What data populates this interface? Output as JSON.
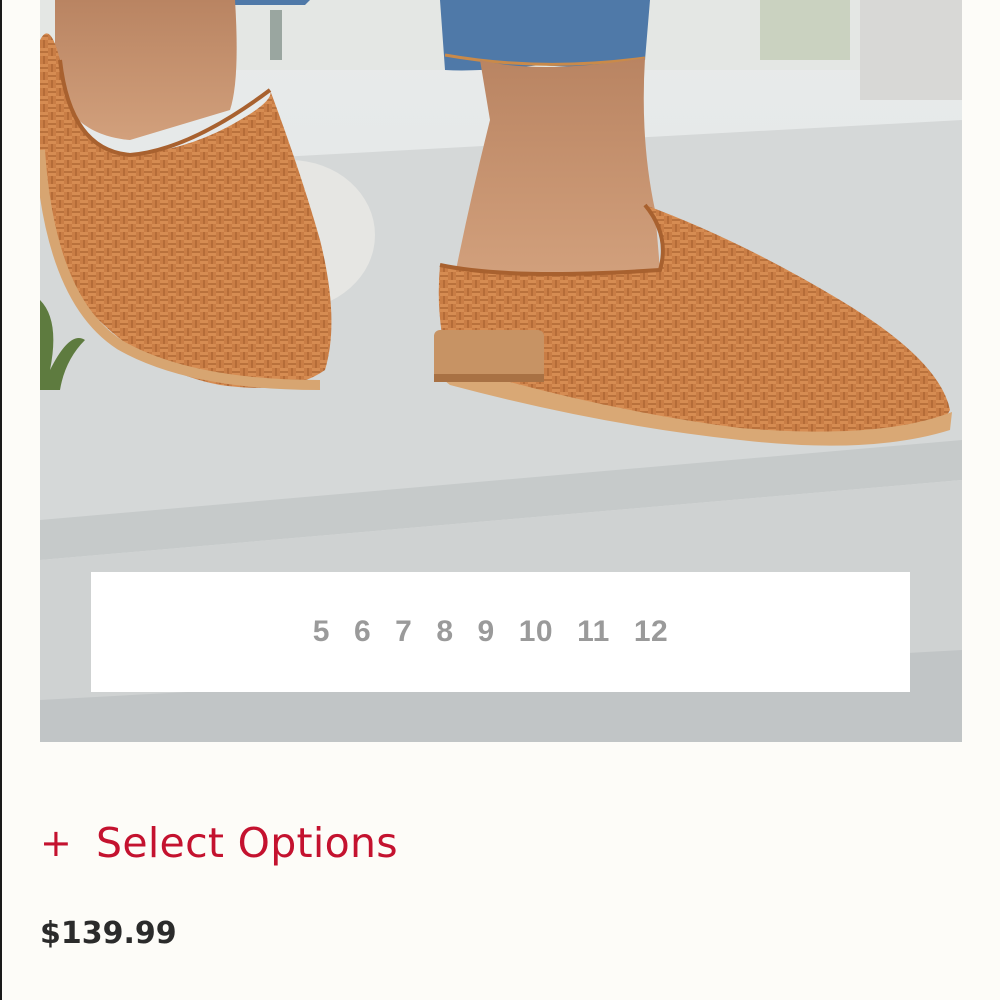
{
  "product": {
    "image_alt": "woven leather mule",
    "sizes": [
      "5",
      "6",
      "7",
      "8",
      "9",
      "10",
      "11",
      "12"
    ],
    "select_options_label": "Select Options",
    "price": "$139.99"
  },
  "colors": {
    "accent": "#c4122f",
    "size_text": "#9a9a9a",
    "price_text": "#2b2b2b",
    "background": "#fdfcf8"
  }
}
